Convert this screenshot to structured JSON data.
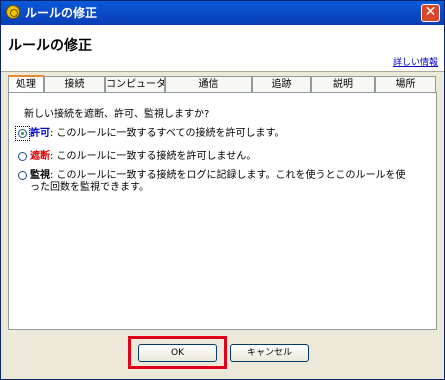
{
  "window": {
    "title": "ルールの修正",
    "close_glyph": "✕"
  },
  "header": {
    "title": "ルールの修正",
    "detail_link": "詳しい情報"
  },
  "tabs": [
    {
      "label": "処理"
    },
    {
      "label": "接続"
    },
    {
      "label": "コンピュータ"
    },
    {
      "label": "通信"
    },
    {
      "label": "追跡"
    },
    {
      "label": "説明"
    },
    {
      "label": "場所"
    }
  ],
  "panel": {
    "question": "新しい接続を遮断、許可、監視しますか?",
    "options": [
      {
        "keyword": "許可",
        "description": ": このルールに一致するすべての接続を許可します。",
        "checked": true
      },
      {
        "keyword": "遮断",
        "description": ": このルールに一致する接続を許可しません。",
        "checked": false
      },
      {
        "keyword": "監視",
        "description": ": このルールに一致する接続をログに記録します。これを使うとこのルールを使った回数を監視できます。",
        "checked": false
      }
    ]
  },
  "buttons": {
    "ok": "OK",
    "cancel": "キャンセル"
  },
  "colors": {
    "titlebar": "#0a48c7",
    "allow_keyword": "#0000cc",
    "block_keyword": "#dd0000",
    "highlight": "#e0001a"
  }
}
